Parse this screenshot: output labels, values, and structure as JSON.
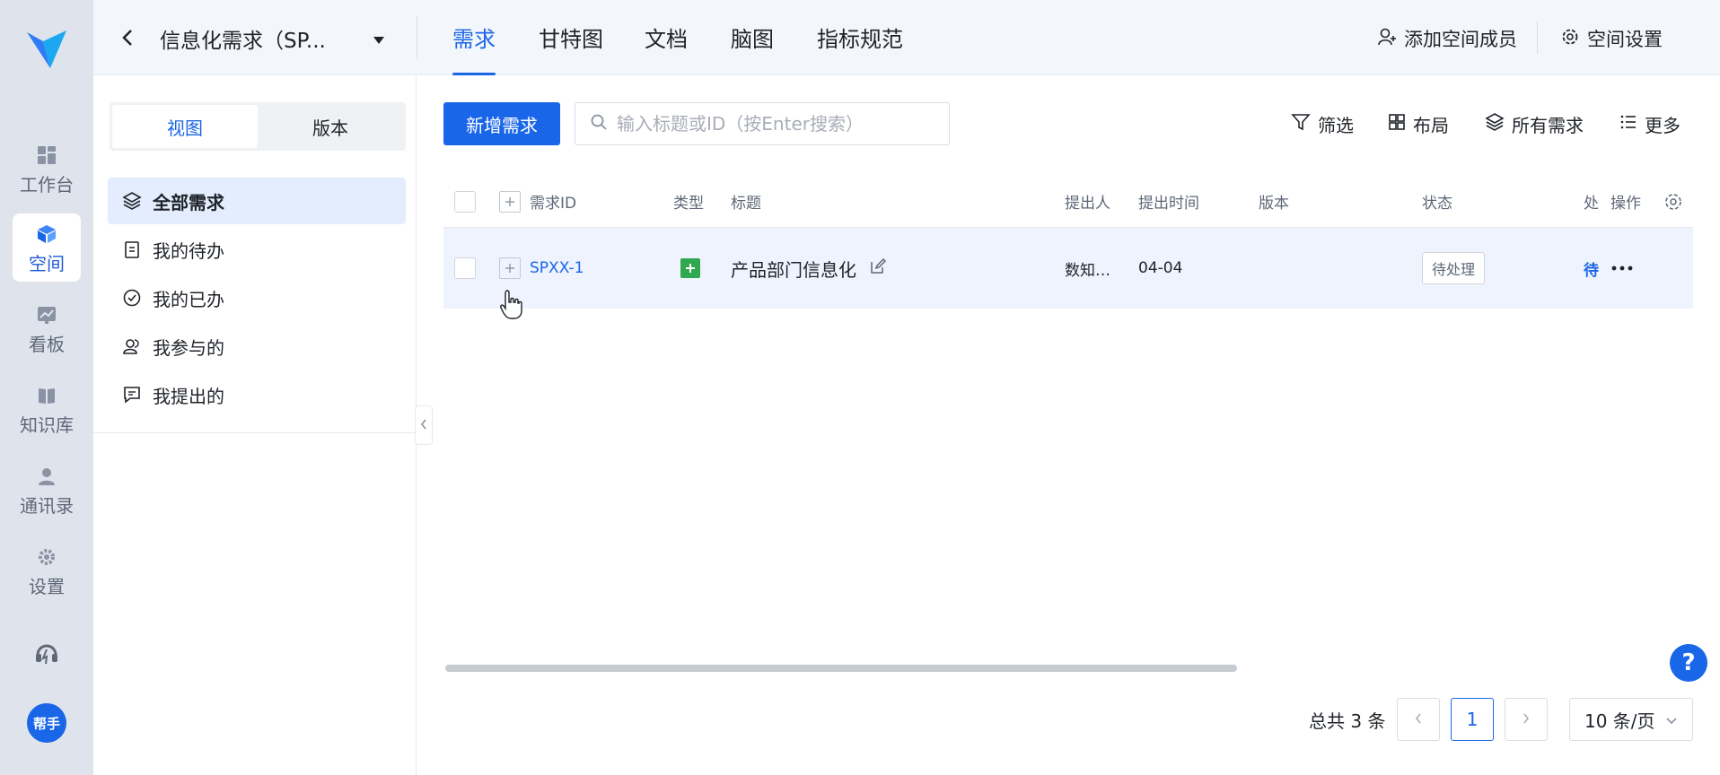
{
  "rail": {
    "items": [
      {
        "label": "工作台",
        "icon": "dashboard-icon"
      },
      {
        "label": "空间",
        "icon": "cube-icon"
      },
      {
        "label": "看板",
        "icon": "chart-board-icon"
      },
      {
        "label": "知识库",
        "icon": "book-icon"
      },
      {
        "label": "通讯录",
        "icon": "contact-icon"
      },
      {
        "label": "设置",
        "icon": "gear-icon"
      }
    ],
    "help_label": "帮手"
  },
  "header": {
    "space_name": "信息化需求（SP...",
    "tabs": [
      "需求",
      "甘特图",
      "文档",
      "脑图",
      "指标规范"
    ],
    "active_tab": "需求",
    "add_member": "添加空间成员",
    "space_settings": "空间设置"
  },
  "left_panel": {
    "segments": [
      "视图",
      "版本"
    ],
    "nav": [
      {
        "label": "全部需求",
        "icon": "layers-icon"
      },
      {
        "label": "我的待办",
        "icon": "clipboard-icon"
      },
      {
        "label": "我的已办",
        "icon": "check-circle-icon"
      },
      {
        "label": "我参与的",
        "icon": "people-icon"
      },
      {
        "label": "我提出的",
        "icon": "message-icon"
      }
    ]
  },
  "toolbar": {
    "add_label": "新增需求",
    "search_placeholder": "输入标题或ID（按Enter搜索）",
    "filter": "筛选",
    "layout": "布局",
    "all_requirements": "所有需求",
    "more": "更多"
  },
  "table": {
    "headers": {
      "id": "需求ID",
      "type": "类型",
      "title": "标题",
      "submitter": "提出人",
      "submit_time": "提出时间",
      "version": "版本",
      "status": "状态",
      "handler": "处",
      "actions": "操作"
    },
    "rows": [
      {
        "id": "SPXX-1",
        "title": "产品部门信息化",
        "submitter": "数知…",
        "submit_time": "04-04",
        "version": "",
        "status": "待处理",
        "handler": "待"
      }
    ]
  },
  "pagination": {
    "total": "总共 3 条",
    "current_page": "1",
    "page_size": "10 条/页"
  },
  "colors": {
    "primary": "#1a66e8",
    "rail_bg": "#dfe4ec",
    "row_highlight": "#eef3fd",
    "type_green": "#2fa84f"
  }
}
